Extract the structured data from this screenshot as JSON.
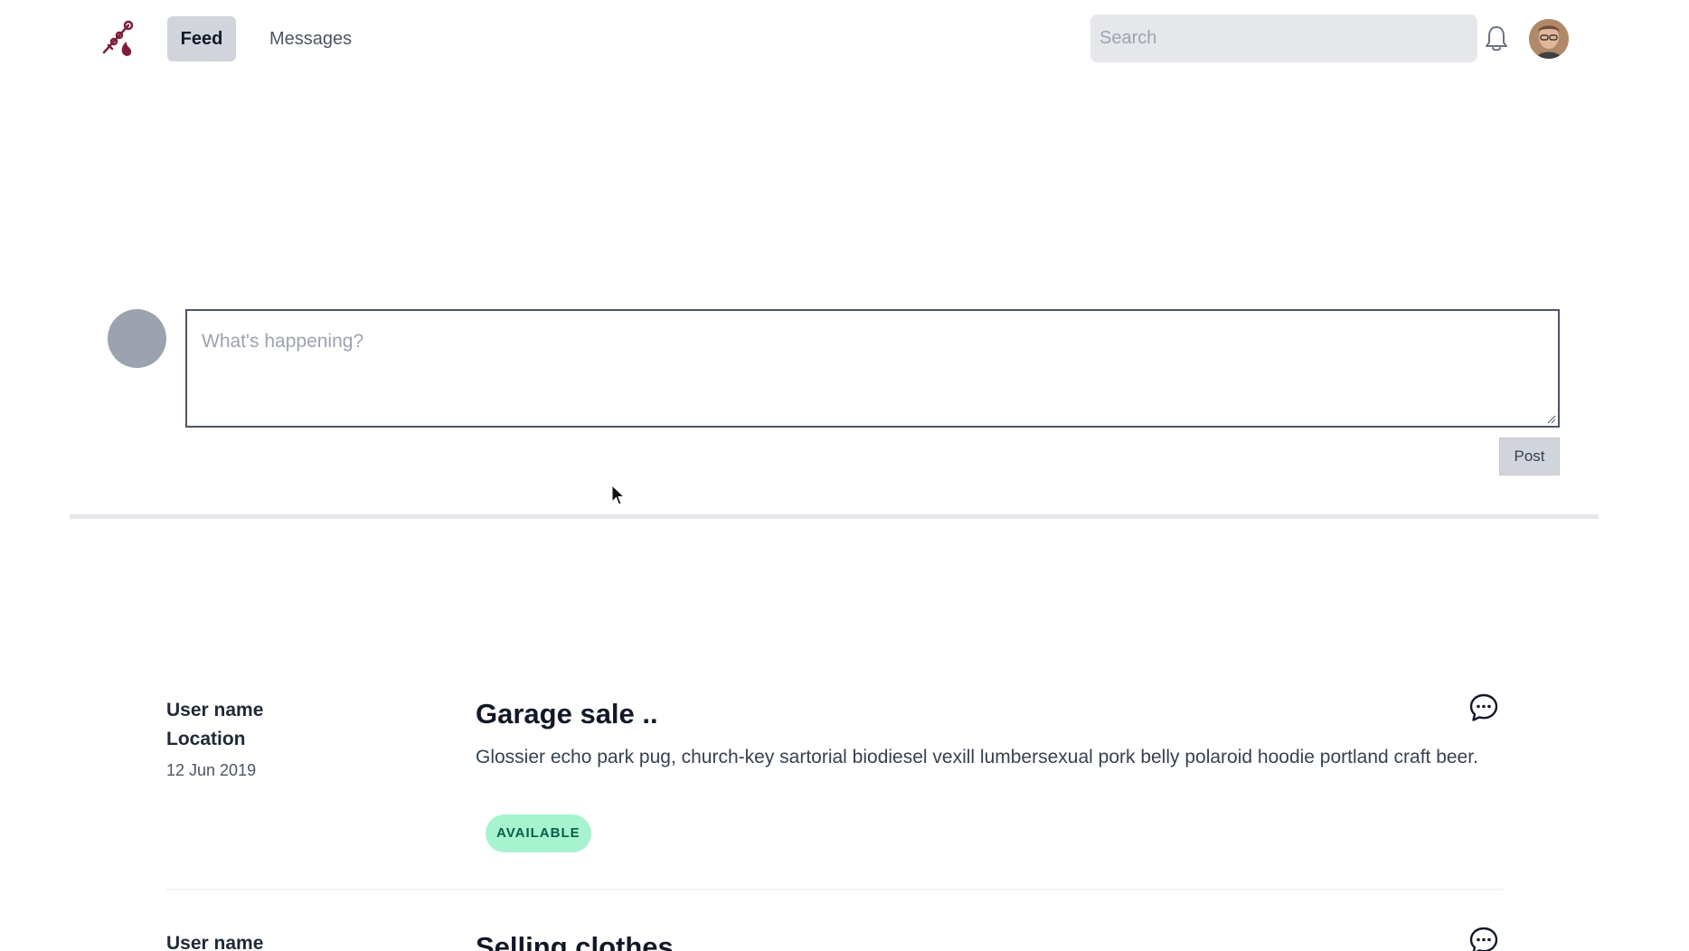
{
  "nav": {
    "feed_label": "Feed",
    "messages_label": "Messages",
    "search_placeholder": "Search",
    "logo_icon": "flame-skewer-logo-icon",
    "bell_icon": "bell-icon",
    "avatar_icon": "user-avatar-icon"
  },
  "composer": {
    "placeholder": "What's happening?",
    "post_label": "Post"
  },
  "posts": [
    {
      "user": "User name",
      "location": "Location",
      "date": "12 Jun 2019",
      "title": "Garage sale ..",
      "body": "Glossier echo park pug, church-key sartorial biodiesel vexill lumbersexual pork belly polaroid hoodie portland craft beer.",
      "status": "AVAILABLE",
      "comment_icon": "chat-bubble-icon"
    },
    {
      "user": "User name",
      "title": "Selling clothes",
      "comment_icon": "chat-bubble-icon"
    }
  ],
  "colors": {
    "accent_logo": "#7f1d3a",
    "badge_bg": "#a7f3d0",
    "badge_text": "#065f46"
  }
}
